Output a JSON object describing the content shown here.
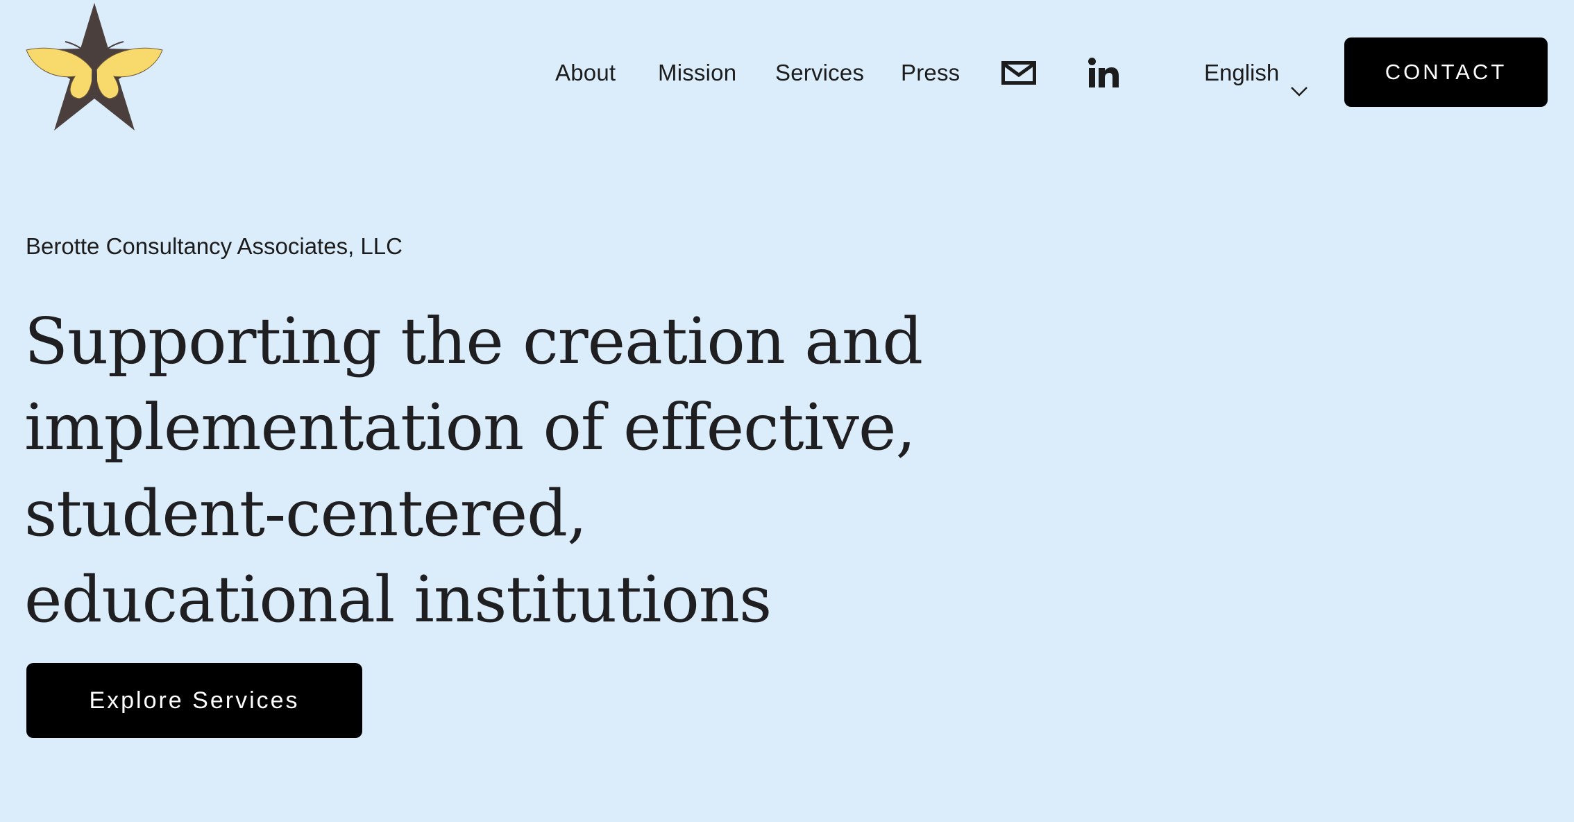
{
  "header": {
    "logo_icon": "star-butterfly-logo-icon",
    "nav": {
      "about": "About",
      "mission": "Mission",
      "services": "Services",
      "press": "Press"
    },
    "icons": {
      "mail": "mail-icon",
      "linkedin": "linkedin-icon"
    },
    "language": {
      "selected": "English",
      "icon": "chevron-down-icon"
    },
    "contact_label": "CONTACT"
  },
  "hero": {
    "company": "Berotte Consultancy Associates, LLC",
    "headline": "Supporting the creation and implementation of effective, student-centered, educational institutions",
    "cta_label": "Explore Services"
  },
  "colors": {
    "background": "#dbedfb",
    "button": "#000000",
    "button_text": "#ffffff",
    "logo_star": "#4a3f3c",
    "logo_butterfly": "#f8d96b",
    "text": "#1c1c1c"
  }
}
